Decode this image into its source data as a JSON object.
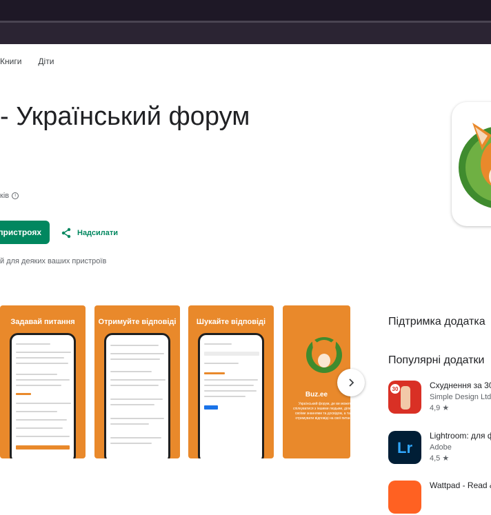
{
  "nav": {
    "books": "Книги",
    "kids": "Діти"
  },
  "app": {
    "title": "- Український форум",
    "developer_partial": "ків",
    "install_label": "пристроях",
    "share_label": "Надсилати",
    "compat_text": "й для деяких ваших пристроїв"
  },
  "screenshots": [
    {
      "caption": "Задавай питання"
    },
    {
      "caption": "Отримуйте відповіді"
    },
    {
      "caption": "Шукайте відповіді"
    },
    {
      "caption": "Buz.ee",
      "subtitle": "Український форум, де ви можете спілкуватися з іншими людьми, ділитися своїми знаннями та досвідом, а також отримувати відповіді на свої питання."
    }
  ],
  "side": {
    "support_heading": "Підтримка додатка",
    "popular_heading": "Популярні додатки",
    "apps": [
      {
        "name": "Схуднення за 30",
        "developer": "Simple Design Ltd.",
        "rating": "4,9 ★"
      },
      {
        "name": "Lightroom: для ф",
        "developer": "Adobe",
        "rating": "4,5 ★"
      },
      {
        "name": "Wattpad - Read &",
        "developer": "",
        "rating": ""
      }
    ]
  },
  "icons": [
    "info-icon",
    "share-icon",
    "chevron-right-icon",
    "app-logo-icon"
  ],
  "colors": {
    "primary": "#01875f",
    "orange": "#e9892b",
    "browser": "#221c2b"
  }
}
